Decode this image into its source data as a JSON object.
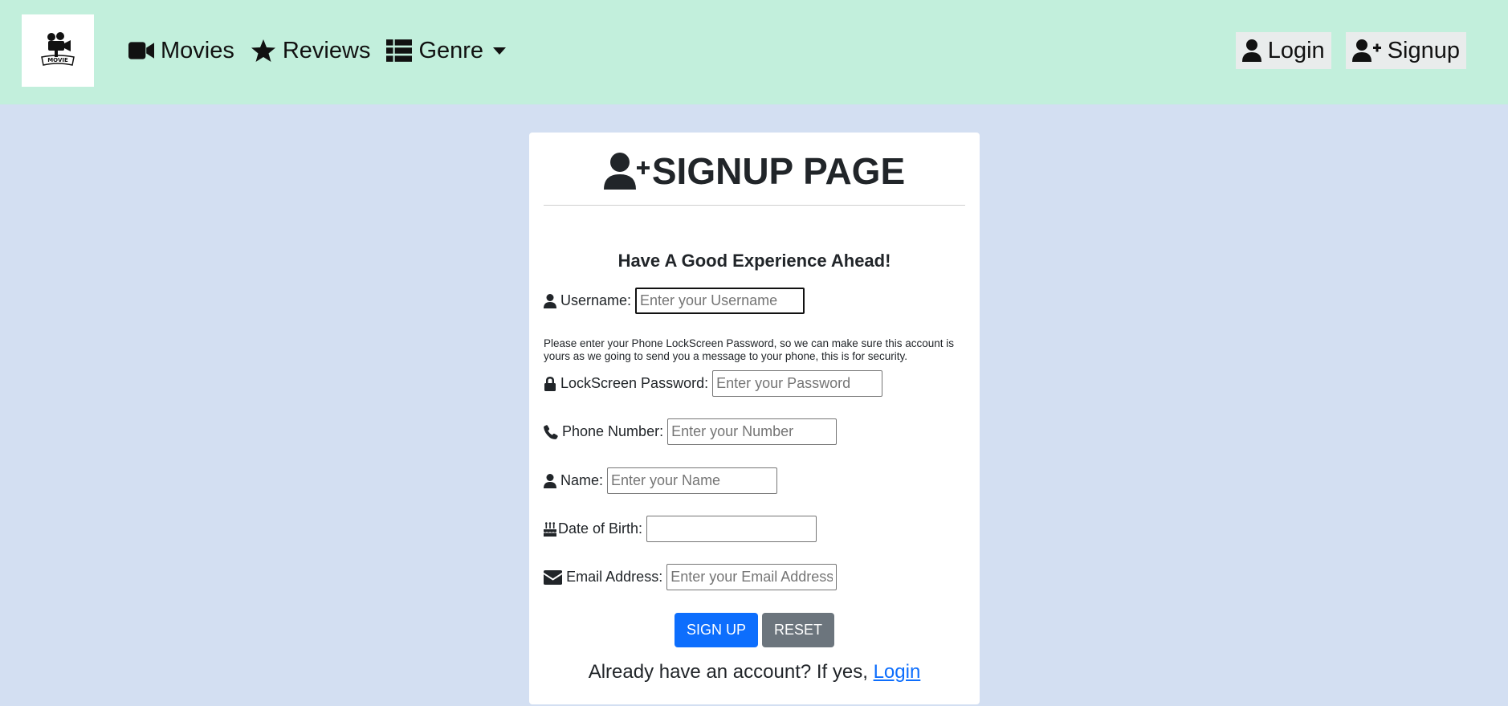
{
  "navbar": {
    "logo_text": "MOVIE",
    "links": [
      {
        "label": "Movies",
        "icon": "video-camera-icon"
      },
      {
        "label": "Reviews",
        "icon": "star-icon"
      },
      {
        "label": "Genre",
        "icon": "list-icon"
      }
    ],
    "login_label": "Login",
    "signup_label": "Signup"
  },
  "form": {
    "title": "SIGNUP PAGE",
    "subheading": "Have A Good Experience Ahead!",
    "username": {
      "label": "Username:",
      "placeholder": "Enter your Username"
    },
    "note": "Please enter your Phone LockScreen Password, so we can make sure this account is yours as we going to send you a message to your phone, this is for security.",
    "password": {
      "label": "LockScreen Password:",
      "placeholder": "Enter your Password"
    },
    "phone": {
      "label": "Phone Number:",
      "placeholder": "Enter your Number"
    },
    "name": {
      "label": "Name:",
      "placeholder": "Enter your Name"
    },
    "dob": {
      "label": "Date of Birth:",
      "value": ""
    },
    "email": {
      "label": "Email Address:",
      "placeholder": "Enter your Email Address"
    },
    "signup_button": "SIGN UP",
    "reset_button": "RESET",
    "footer_text": "Already have an account? If yes, ",
    "footer_link": "Login"
  },
  "colors": {
    "navbar_bg": "#c2efdc",
    "page_bg": "#d3dff2",
    "primary": "#0d6efd",
    "secondary": "#6c757d"
  }
}
